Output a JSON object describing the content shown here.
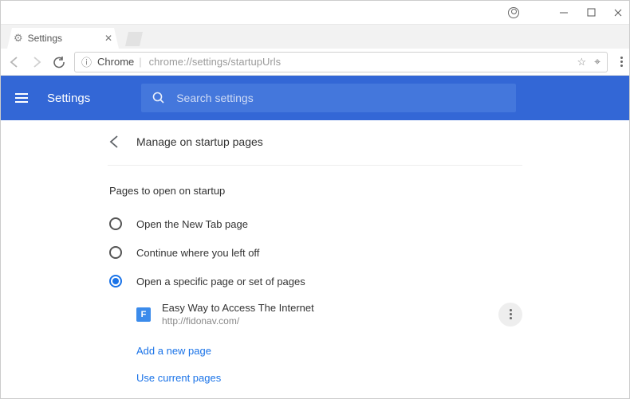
{
  "window": {
    "tab_title": "Settings"
  },
  "omnibox": {
    "chip_label": "Chrome",
    "url": "chrome://settings/startupUrls"
  },
  "header": {
    "title": "Settings",
    "search_placeholder": "Search settings"
  },
  "panel": {
    "title": "Manage on startup pages",
    "section_title": "Pages to open on startup",
    "options": {
      "new_tab": "Open the New Tab page",
      "continue": "Continue where you left off",
      "specific": "Open a specific page or set of pages"
    },
    "page": {
      "favicon_letter": "F",
      "title": "Easy Way to Access The Internet",
      "url": "http://fidonav.com/"
    },
    "add_page": "Add a new page",
    "use_current": "Use current pages"
  }
}
